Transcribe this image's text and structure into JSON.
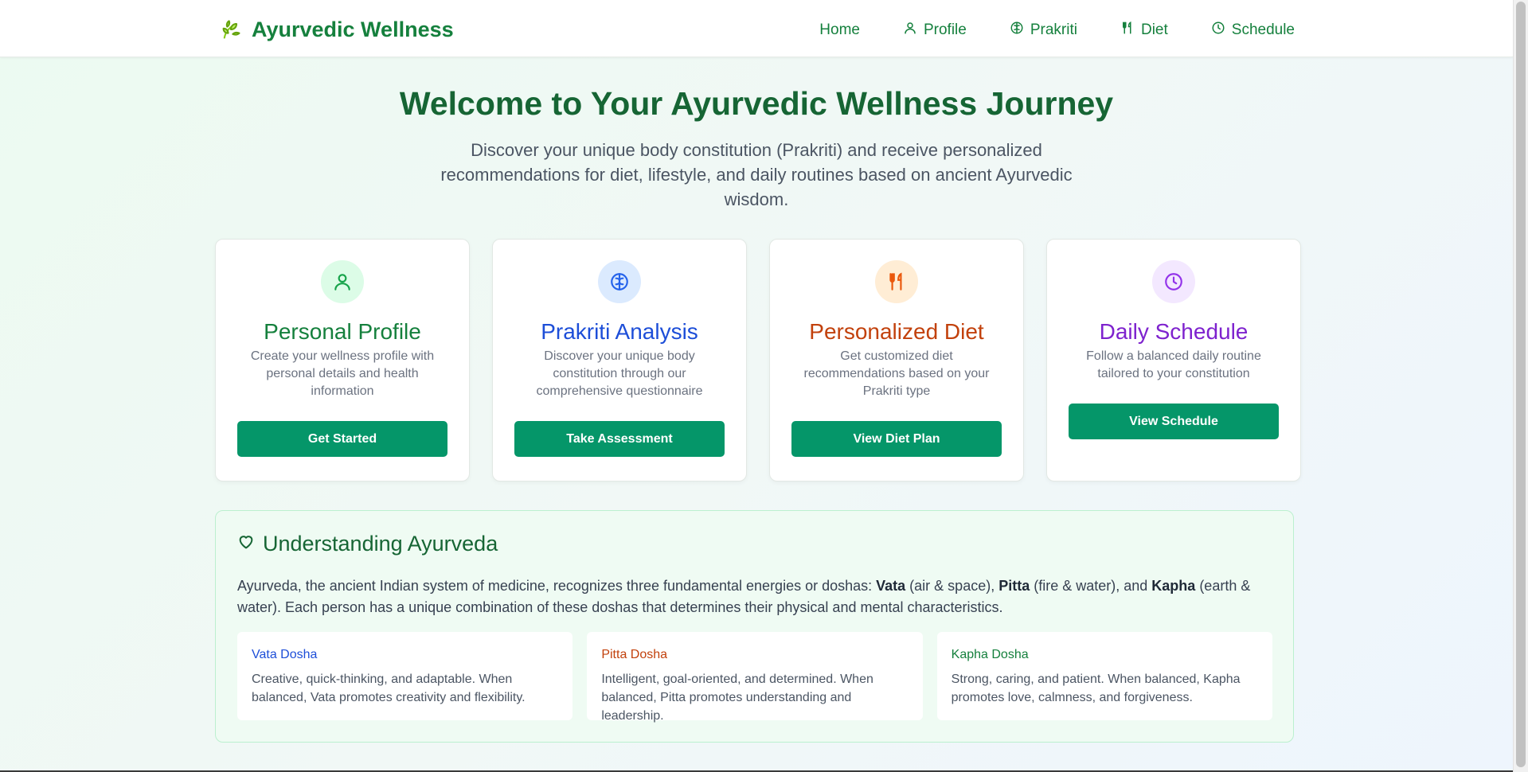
{
  "brand": {
    "title": "Ayurvedic Wellness",
    "icon": "leaf-icon"
  },
  "nav": [
    {
      "label": "Home",
      "icon": ""
    },
    {
      "label": "Profile",
      "icon": "user-icon"
    },
    {
      "label": "Prakriti",
      "icon": "brain-icon"
    },
    {
      "label": "Diet",
      "icon": "utensils-icon"
    },
    {
      "label": "Schedule",
      "icon": "clock-icon"
    }
  ],
  "hero": {
    "title": "Welcome to Your Ayurvedic Wellness Journey",
    "subtitle": "Discover your unique body constitution (Prakriti) and receive personalized recommendations for diet, lifestyle, and daily routines based on ancient Ayurvedic wisdom."
  },
  "cards": [
    {
      "icon": "user-icon",
      "title": "Personal Profile",
      "description": "Create your wellness profile with personal details and health information",
      "button": "Get Started",
      "accent": "#15803d",
      "icon_bg": "#dcfce7"
    },
    {
      "icon": "brain-icon",
      "title": "Prakriti Analysis",
      "description": "Discover your unique body constitution through our comprehensive questionnaire",
      "button": "Take Assessment",
      "accent": "#1d4ed8",
      "icon_bg": "#dbeafe"
    },
    {
      "icon": "utensils-icon",
      "title": "Personalized Diet",
      "description": "Get customized diet recommendations based on your Prakriti type",
      "button": "View Diet Plan",
      "accent": "#c2410c",
      "icon_bg": "#ffedd5"
    },
    {
      "icon": "clock-icon",
      "title": "Daily Schedule",
      "description": "Follow a balanced daily routine tailored to your constitution",
      "button": "View Schedule",
      "accent": "#7e22ce",
      "icon_bg": "#f3e8ff"
    }
  ],
  "understanding": {
    "icon": "heart-icon",
    "title": "Understanding Ayurveda",
    "text_parts": [
      "Ayurveda, the ancient Indian system of medicine, recognizes three fundamental energies or doshas: ",
      "Vata",
      " (air & space), ",
      "Pitta",
      " (fire & water), and ",
      "Kapha",
      " (earth & water). Each person has a unique combination of these doshas that determines their physical and mental characteristics."
    ],
    "doshas": [
      {
        "name": "Vata Dosha",
        "description": "Creative, quick-thinking, and adaptable. When balanced, Vata promotes creativity and flexibility.",
        "color": "#1d4ed8"
      },
      {
        "name": "Pitta Dosha",
        "description": "Intelligent, goal-oriented, and determined. When balanced, Pitta promotes understanding and leadership.",
        "color": "#c2410c"
      },
      {
        "name": "Kapha Dosha",
        "description": "Strong, caring, and patient. When balanced, Kapha promotes love, calmness, and forgiveness.",
        "color": "#15803d"
      }
    ]
  },
  "colors": {
    "primary_button": "#059669",
    "brand_green": "#15803d"
  }
}
